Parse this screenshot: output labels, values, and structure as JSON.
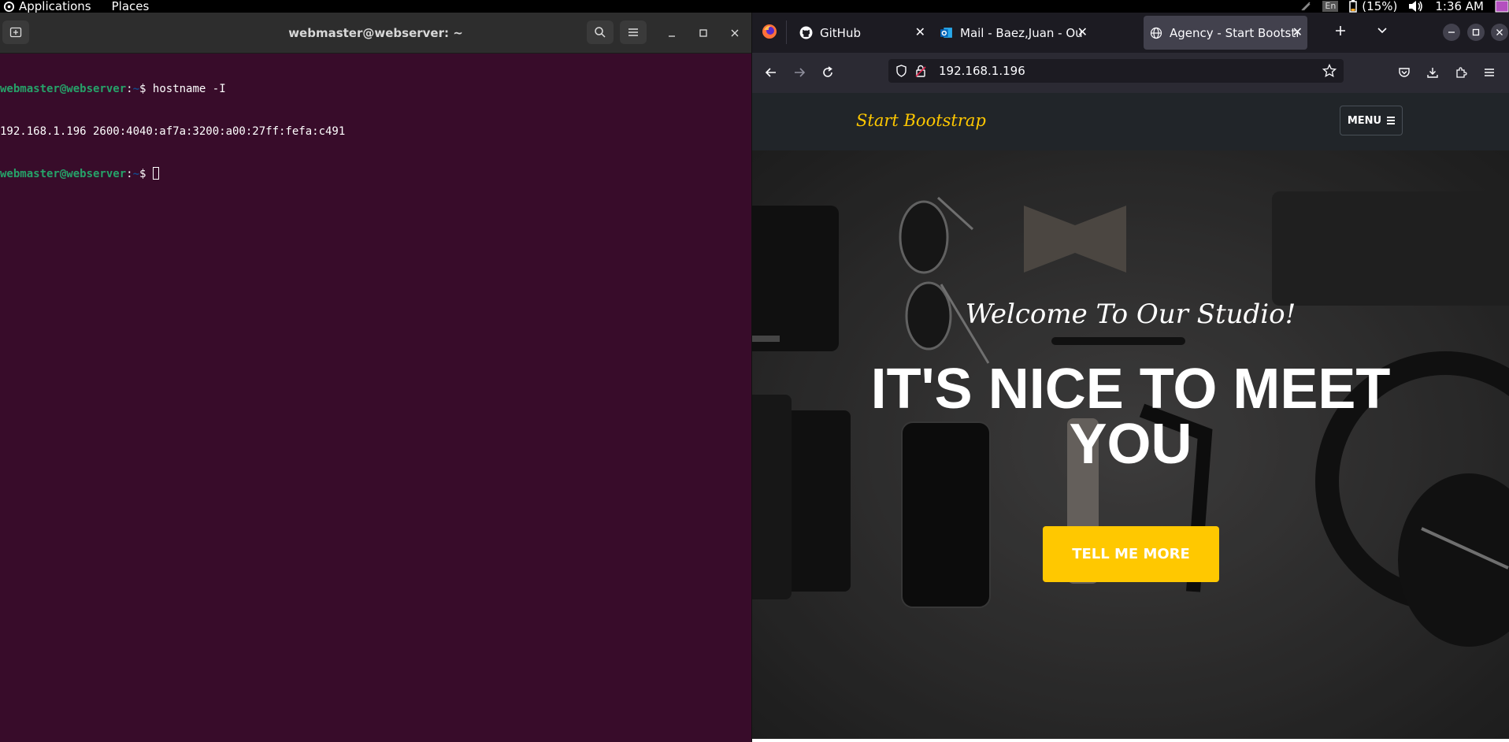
{
  "topbar": {
    "menu_items": [
      "Applications",
      "Places"
    ],
    "keyboard_layout": "En",
    "battery": "(15%)",
    "time": "1:36 AM"
  },
  "terminal": {
    "title": "webmaster@webserver: ~",
    "lines": [
      {
        "user": "webmaster@webserver",
        "path": "~",
        "symbol": "$",
        "command": "hostname -I"
      },
      {
        "output": "192.168.1.196 2600:4040:af7a:3200:a00:27ff:fefa:c491"
      },
      {
        "user": "webmaster@webserver",
        "path": "~",
        "symbol": "$",
        "command": ""
      }
    ],
    "colors": {
      "background": "#380c2a",
      "user": "#26a269",
      "path": "#12488b"
    }
  },
  "browser": {
    "tabs": [
      {
        "label": "GitHub",
        "icon": "github-icon"
      },
      {
        "label": "Mail - Baez,Juan - Outlook",
        "icon": "outlook-icon"
      },
      {
        "label": "Agency - Start Bootstrap",
        "icon": "globe-icon",
        "active": true
      }
    ],
    "url": "192.168.1.196"
  },
  "page": {
    "brand": "Start Bootstrap",
    "menu_label": "MENU",
    "hero_lead": "Welcome To Our Studio!",
    "hero_heading": "IT'S NICE TO MEET YOU",
    "hero_button": "TELL ME MORE",
    "colors": {
      "accent": "#ffc800",
      "nav": "#212529"
    }
  }
}
